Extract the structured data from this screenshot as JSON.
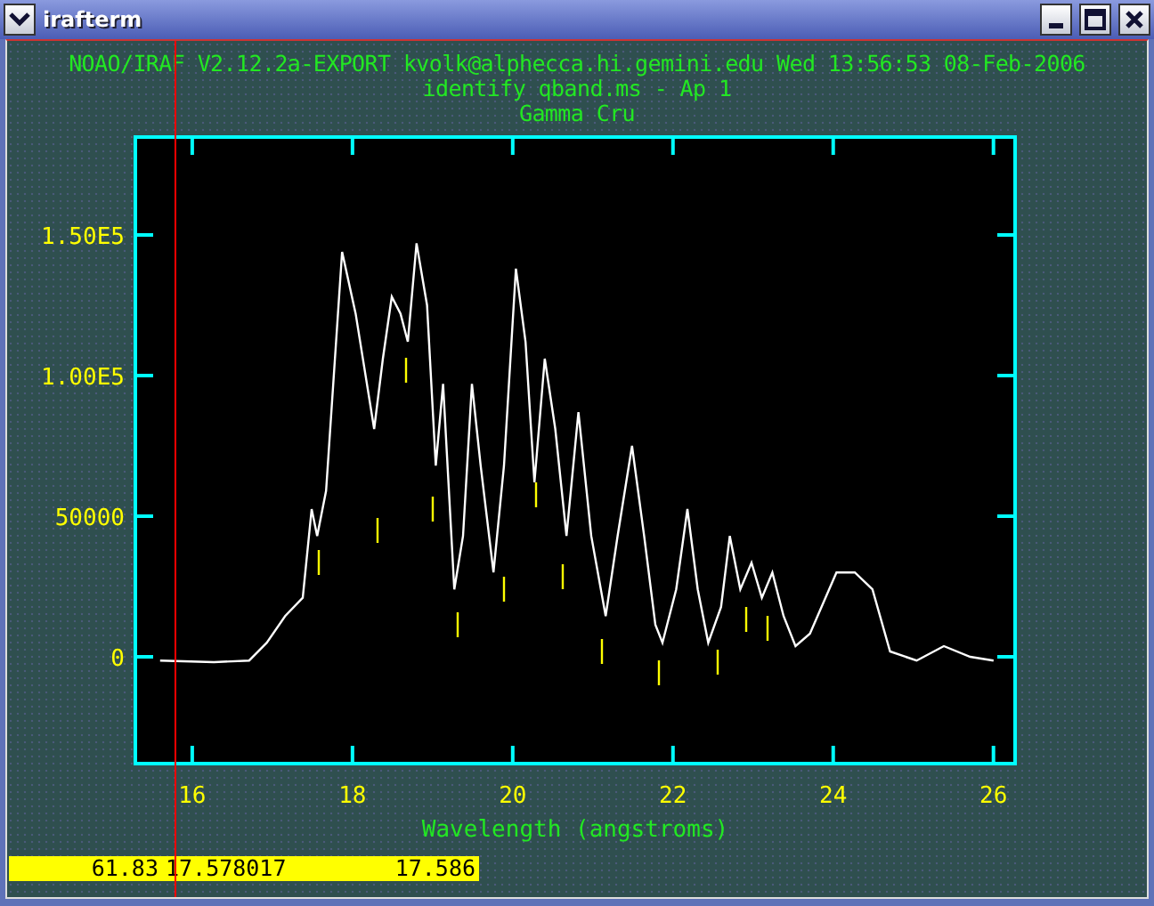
{
  "window": {
    "title": "irafterm"
  },
  "header": [
    "NOAO/IRAF V2.12.2a-EXPORT kvolk@alphecca.hi.gemini.edu Wed 13:56:53 08-Feb-2006",
    "identify qband.ms - Ap 1",
    "Gamma Cru"
  ],
  "plot": {
    "chart_data": {
      "type": "line",
      "xlabel": "Wavelength (angstroms)",
      "xlim": [
        15.29,
        26.27
      ],
      "ylim": [
        -37975,
        184800
      ],
      "xticks": [
        16,
        18,
        20,
        22,
        24,
        26
      ],
      "yticks": [
        {
          "value": 0,
          "label": "0"
        },
        {
          "value": 50000,
          "label": "50000"
        },
        {
          "value": 100000,
          "label": "1.00E5"
        },
        {
          "value": 150000,
          "label": "1.50E5"
        }
      ],
      "x": [
        15.6,
        16.27,
        16.71,
        16.93,
        17.16,
        17.38,
        17.49,
        17.56,
        17.67,
        17.87,
        18.04,
        18.27,
        18.38,
        18.49,
        18.6,
        18.69,
        18.8,
        18.93,
        19.04,
        19.13,
        19.27,
        19.38,
        19.49,
        19.6,
        19.76,
        19.89,
        20.04,
        20.16,
        20.27,
        20.4,
        20.53,
        20.67,
        20.82,
        20.98,
        21.16,
        21.31,
        21.49,
        21.64,
        21.78,
        21.87,
        22.04,
        22.18,
        22.31,
        22.44,
        22.6,
        22.71,
        22.84,
        22.98,
        23.11,
        23.24,
        23.38,
        23.53,
        23.71,
        24.04,
        24.27,
        24.49,
        24.71,
        25.04,
        25.38,
        25.71,
        26.0
      ],
      "series": [
        {
          "color": "#ffffff",
          "values": [
            -1300,
            -1900,
            -1300,
            5000,
            14500,
            21000,
            52500,
            43000,
            59000,
            144000,
            122000,
            81000,
            106000,
            128000,
            122000,
            112000,
            147000,
            125000,
            68000,
            97000,
            24000,
            43000,
            97000,
            68000,
            30000,
            68000,
            138000,
            112000,
            62000,
            106000,
            81000,
            43000,
            87000,
            43000,
            14500,
            43000,
            75000,
            43000,
            11400,
            5000,
            24000,
            52500,
            24000,
            5000,
            17700,
            43000,
            24000,
            33500,
            21000,
            30000,
            14500,
            3800,
            8200,
            30000,
            30000,
            24000,
            1900,
            -1300,
            3800,
            0,
            -1300
          ]
        }
      ]
    }
  },
  "status_bar": [
    "61.83",
    "17.578017",
    "17.586"
  ]
}
